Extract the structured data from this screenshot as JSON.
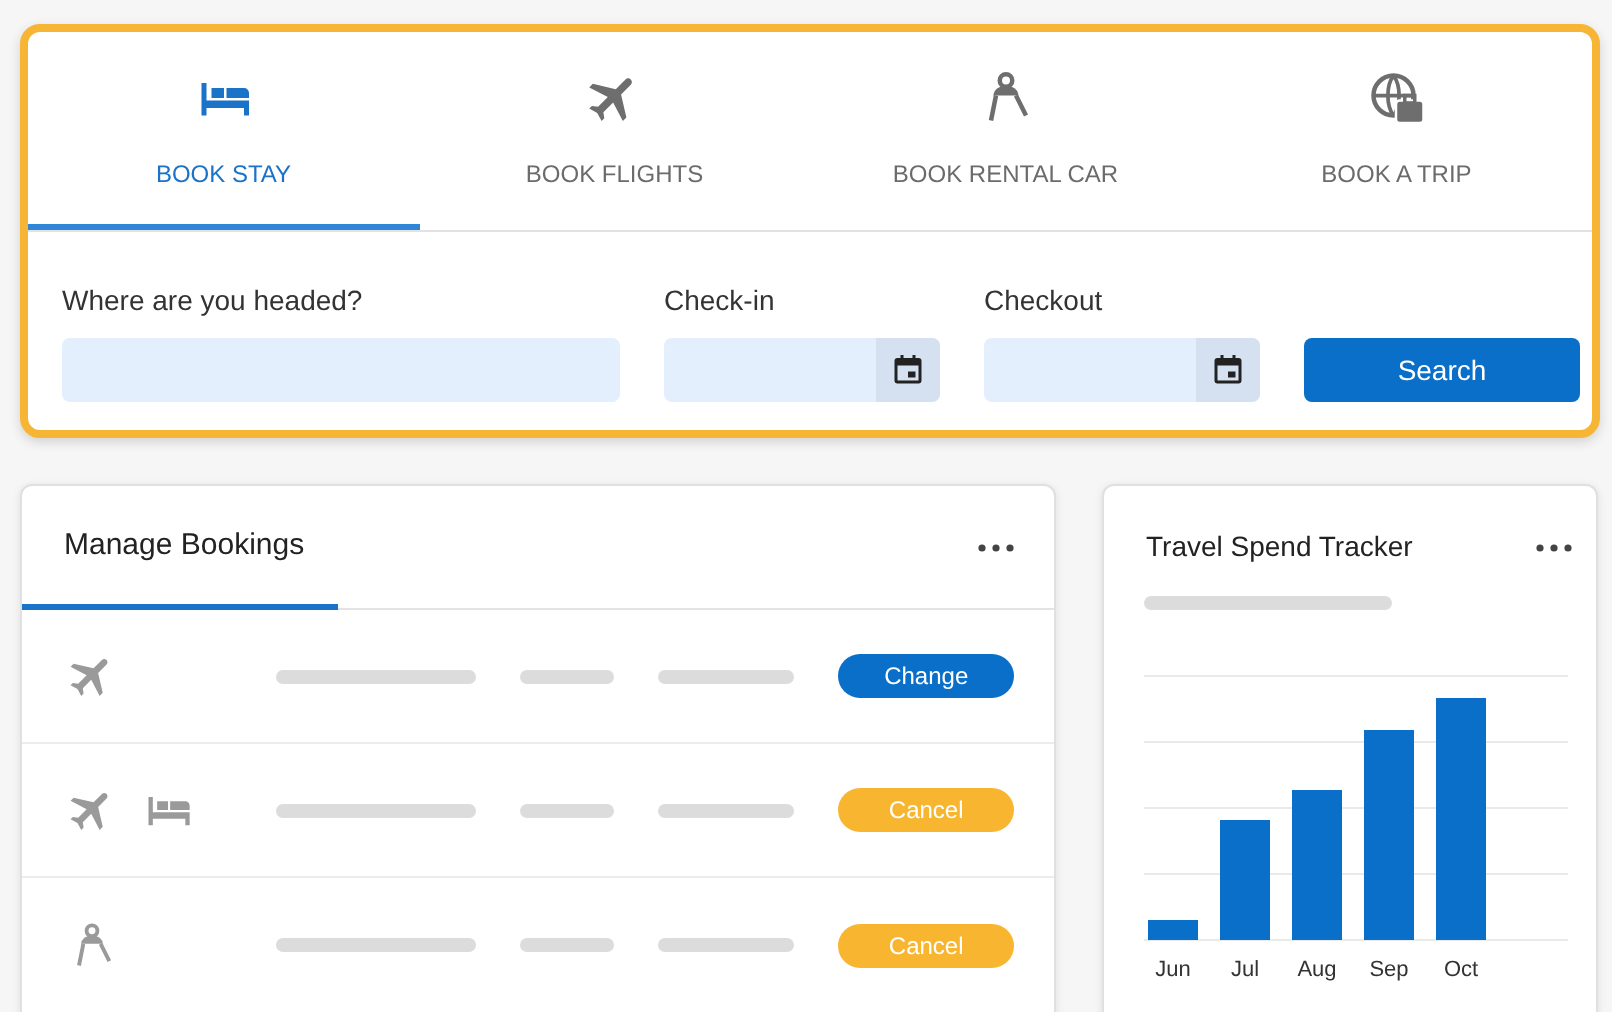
{
  "booking_tabs": [
    {
      "label": "BOOK STAY",
      "kind": "stay",
      "selected": true
    },
    {
      "label": "BOOK FLIGHTS",
      "kind": "flight",
      "selected": false
    },
    {
      "label": "BOOK RENTAL CAR",
      "kind": "car",
      "selected": false
    },
    {
      "label": "BOOK A TRIP",
      "kind": "trip",
      "selected": false
    }
  ],
  "search_form": {
    "fields": [
      {
        "label": "Where are you headed?",
        "kind": "text"
      },
      {
        "label": "Check-in",
        "kind": "date"
      },
      {
        "label": "Checkout",
        "kind": "date"
      }
    ],
    "button": "Search"
  },
  "manage_bookings": {
    "title": "Manage Bookings",
    "rows": [
      {
        "services": [
          {
            "kind": "flight"
          }
        ],
        "action": {
          "label": "Change",
          "kind": "primary"
        }
      },
      {
        "services": [
          {
            "kind": "flight"
          },
          {
            "kind": "stay"
          }
        ],
        "action": {
          "label": "Cancel",
          "kind": "warning"
        }
      },
      {
        "services": [
          {
            "kind": "car"
          }
        ],
        "action": {
          "label": "Cancel",
          "kind": "warning"
        }
      }
    ]
  },
  "spend_tracker": {
    "title": "Travel Spend Tracker",
    "months": [
      "Jun",
      "Jul",
      "Aug",
      "Sep",
      "Oct"
    ]
  }
}
